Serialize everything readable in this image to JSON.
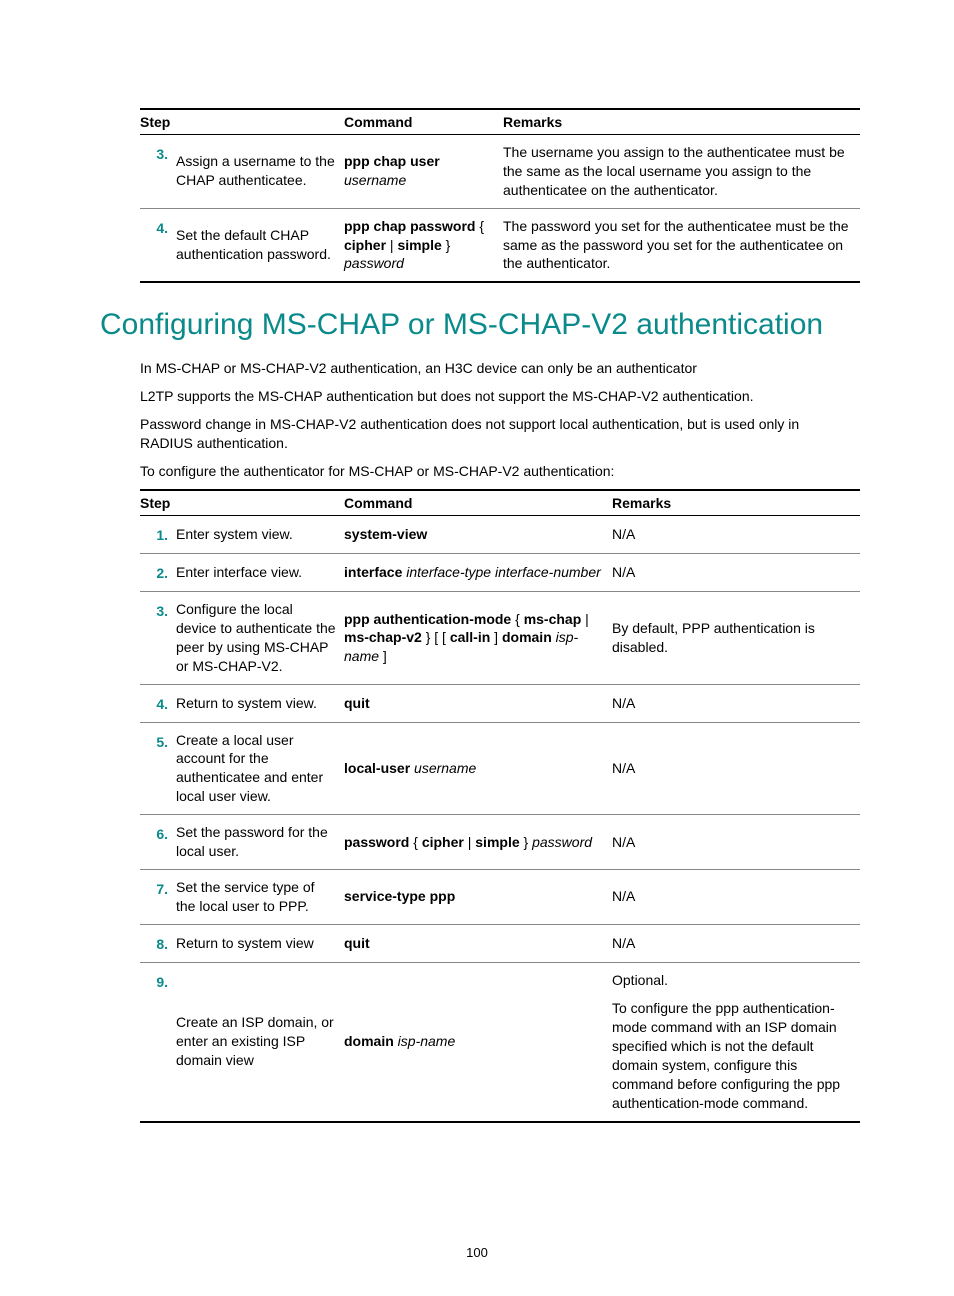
{
  "table1": {
    "headers": [
      "Step",
      "Command",
      "Remarks"
    ],
    "rows": [
      {
        "num": "3.",
        "desc": "Assign a username to the CHAP authenticatee.",
        "cmd_bold1": "ppp chap user",
        "cmd_italic1": " username",
        "remarks": "The username you assign to the authenticatee must be the same as the local username you assign to the authenticatee on the authenticator."
      },
      {
        "num": "4.",
        "desc": "Set the default CHAP authentication password.",
        "cmd_bold1": "ppp chap password",
        "cmd_plain1": " { ",
        "cmd_bold2": "cipher",
        "cmd_plain2": " | ",
        "cmd_bold3": "simple",
        "cmd_plain3": " } ",
        "cmd_italic1": "password",
        "remarks": "The password you set for the authenticatee must be the same as the password you set for the authenticatee on the authenticator."
      }
    ]
  },
  "heading": "Configuring MS-CHAP or MS-CHAP-V2 authentication",
  "para1": "In MS-CHAP or MS-CHAP-V2 authentication, an H3C device can only be an authenticator",
  "para2": "L2TP supports the MS-CHAP authentication but does not support the MS-CHAP-V2 authentication.",
  "para3": "Password change in MS-CHAP-V2 authentication does not support local authentication, but is used only in RADIUS authentication.",
  "para4": "To configure the authenticator for MS-CHAP or MS-CHAP-V2 authentication:",
  "table2": {
    "headers": [
      "Step",
      "Command",
      "Remarks"
    ],
    "rows": [
      {
        "num": "1.",
        "desc": "Enter system view.",
        "cmd_b1": "system-view",
        "remarks": "N/A"
      },
      {
        "num": "2.",
        "desc": "Enter interface view.",
        "cmd_b1": "interface",
        "cmd_i1": " interface-type interface-number",
        "remarks": "N/A"
      },
      {
        "num": "3.",
        "desc": "Configure the local device to authenticate the peer by using MS-CHAP or MS-CHAP-V2.",
        "cmd_b1": "ppp authentication-mode",
        "cmd_p1": " { ",
        "cmd_b2": "ms-chap",
        "cmd_p2": " | ",
        "cmd_b3": "ms-chap-v2",
        "cmd_p3": " } [ [ ",
        "cmd_b4": "call-in",
        "cmd_p4": " ] ",
        "cmd_b5": "domain",
        "cmd_i1": " isp-name",
        "cmd_p5": " ]",
        "remarks": "By default, PPP authentication is disabled."
      },
      {
        "num": "4.",
        "desc": "Return to system view.",
        "cmd_b1": "quit",
        "remarks": "N/A"
      },
      {
        "num": "5.",
        "desc": "Create a local user account for the authenticatee and enter local user view.",
        "cmd_b1": "local-user",
        "cmd_i1": " username",
        "remarks": "N/A"
      },
      {
        "num": "6.",
        "desc": "Set the password for the local user.",
        "cmd_b1": "password",
        "cmd_p1": " { ",
        "cmd_b2": "cipher",
        "cmd_p2": " | ",
        "cmd_b3": "simple",
        "cmd_p3": " } ",
        "cmd_i1": "password",
        "remarks": "N/A"
      },
      {
        "num": "7.",
        "desc": "Set the service type of the local user to PPP.",
        "cmd_b1": "service-type ppp",
        "remarks": "N/A"
      },
      {
        "num": "8.",
        "desc": "Return to system view",
        "cmd_b1": "quit",
        "remarks": "N/A"
      },
      {
        "num": "9.",
        "desc": "Create an ISP domain, or enter an existing ISP domain view",
        "cmd_b1": "domain",
        "cmd_i1": " isp-name",
        "rem_line1": "Optional.",
        "rem_t1": "To configure the ",
        "rem_b1": "ppp authentication-mode",
        "rem_t2": " command with an ISP domain specified which is not the default domain ",
        "rem_b2": "system",
        "rem_t3": ", configure this command before configuring the ",
        "rem_b3": "ppp authentication-mode",
        "rem_t4": " command."
      }
    ]
  },
  "pagenum": "100"
}
